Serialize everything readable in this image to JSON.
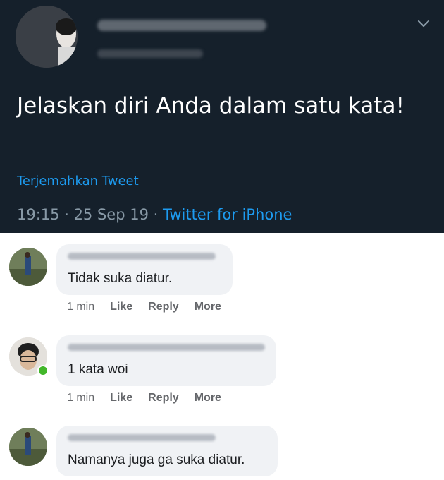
{
  "tweet": {
    "text": "Jelaskan diri Anda dalam satu kata!",
    "translate_label": "Terjemahkan Tweet",
    "time": "19:15",
    "date": "25 Sep 19",
    "source": "Twitter for iPhone",
    "separator": " · "
  },
  "comments": [
    {
      "text": "Tidak suka diatur.",
      "time": "1 min",
      "like": "Like",
      "reply": "Reply",
      "more": "More"
    },
    {
      "text": "1 kata woi",
      "time": "1 min",
      "like": "Like",
      "reply": "Reply",
      "more": "More"
    },
    {
      "text": "Namanya juga ga suka diatur."
    }
  ],
  "colors": {
    "tweet_bg": "#15202b",
    "link": "#1d9bf0",
    "bubble": "#f0f2f5",
    "online": "#42b72a"
  }
}
